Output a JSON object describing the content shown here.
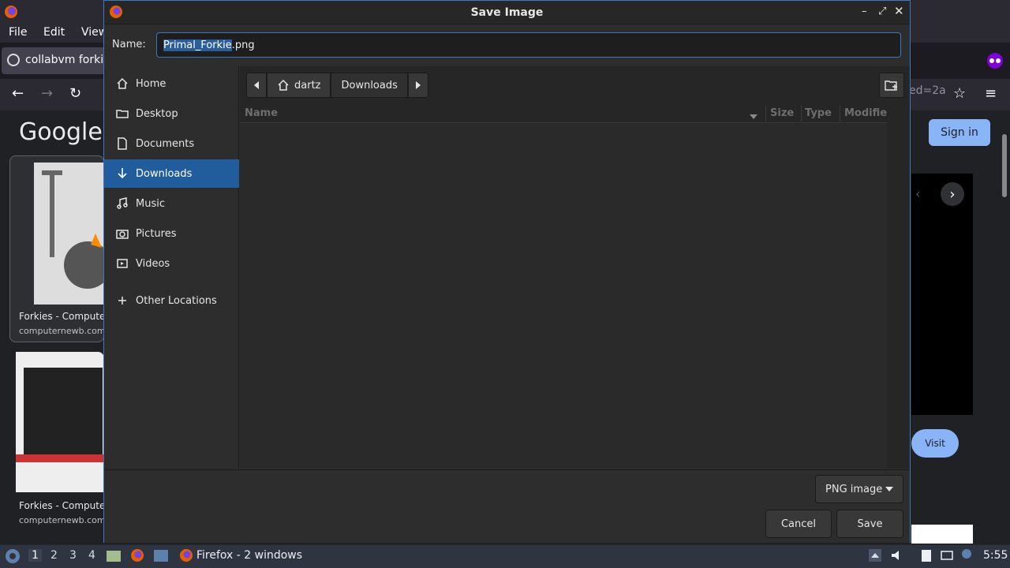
{
  "firefox": {
    "menus": [
      "File",
      "Edit",
      "View"
    ],
    "tab_title": "collabvm forkie",
    "url_tail": "ed=2a",
    "google_logo": "Google",
    "sign_in": "Sign in",
    "visit": "Visit",
    "results": [
      {
        "caption": "Forkies - Computer",
        "source": "computernewb.com"
      },
      {
        "caption": "Forkies - Computer",
        "source": "computernewb.com"
      }
    ]
  },
  "dialog": {
    "title": "Save Image",
    "name_label": "Name:",
    "filename_stem": "Primal_Forkie",
    "filename_ext": ".png",
    "sidebar": [
      {
        "label": "Home",
        "icon": "home-icon"
      },
      {
        "label": "Desktop",
        "icon": "folder-icon"
      },
      {
        "label": "Documents",
        "icon": "document-icon"
      },
      {
        "label": "Downloads",
        "icon": "download-icon",
        "active": true
      },
      {
        "label": "Music",
        "icon": "music-icon"
      },
      {
        "label": "Pictures",
        "icon": "camera-icon"
      },
      {
        "label": "Videos",
        "icon": "video-icon"
      },
      {
        "label": "Other Locations",
        "icon": "plus-icon"
      }
    ],
    "path": [
      "dartz",
      "Downloads"
    ],
    "columns": [
      "Name",
      "Size",
      "Type",
      "Modifie"
    ],
    "filetype": "PNG image",
    "cancel": "Cancel",
    "save": "Save"
  },
  "taskbar": {
    "workspaces": [
      "1",
      "2",
      "3",
      "4"
    ],
    "task_label": "Firefox - 2 windows",
    "clock": "5:55"
  },
  "colors": {
    "accent": "#3a78c2",
    "selection": "#215d9c",
    "signin": "#8ab4f8"
  }
}
